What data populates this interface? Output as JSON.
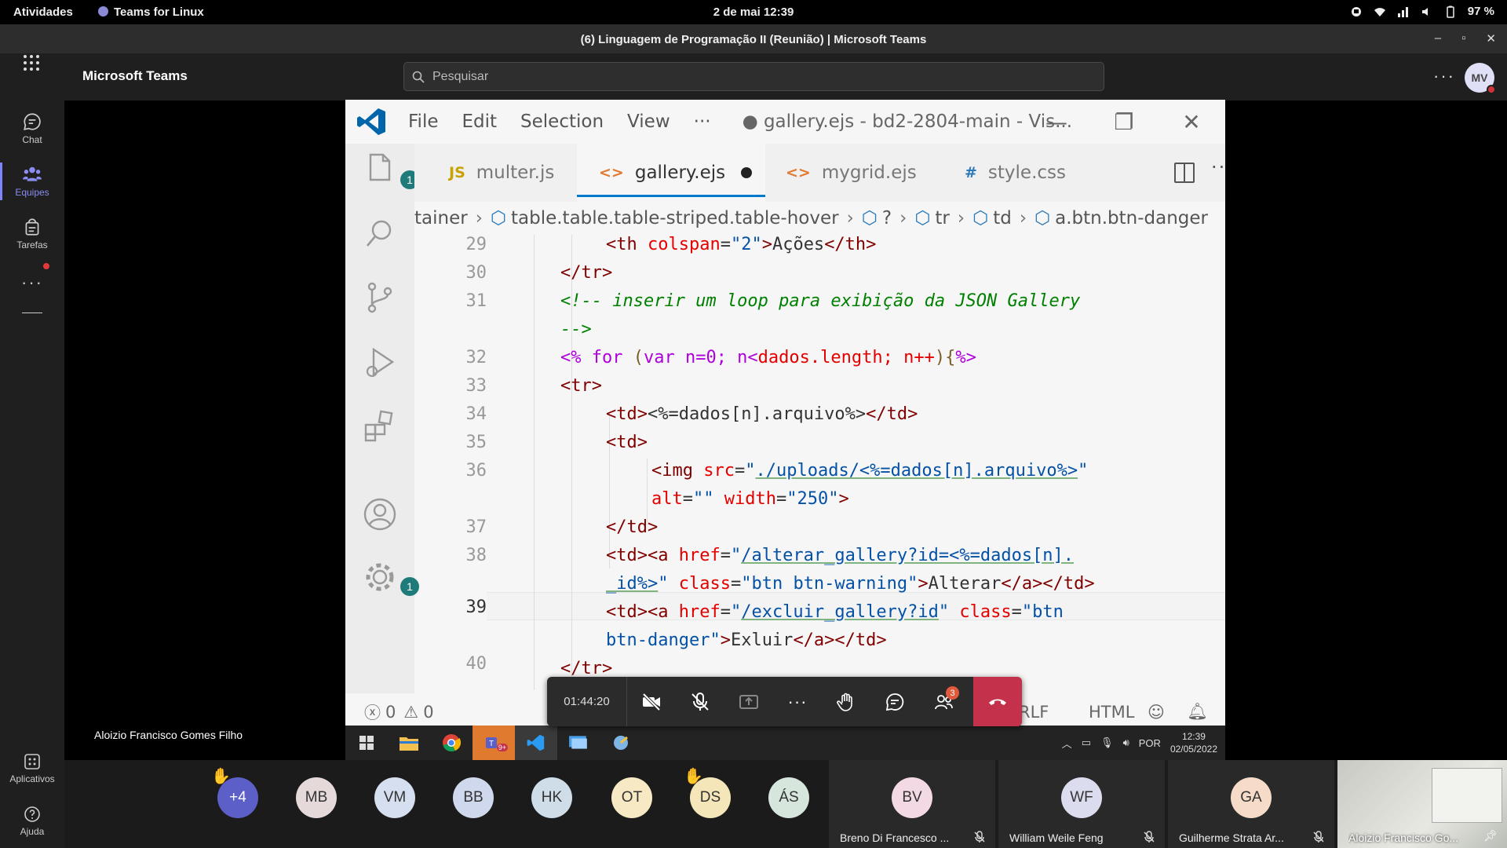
{
  "gnome": {
    "activities": "Atividades",
    "app_name": "Teams for Linux",
    "datetime": "2 de mai  12:39",
    "battery": "97 %"
  },
  "window": {
    "title": "(6) Linguagem de Programação II (Reunião) | Microsoft Teams"
  },
  "rail": {
    "items": [
      {
        "label": "Chat",
        "icon": "chat-icon"
      },
      {
        "label": "Equipes",
        "icon": "teams-icon"
      },
      {
        "label": "Tarefas",
        "icon": "tasks-icon"
      }
    ],
    "bottom": [
      {
        "label": "Aplicativos",
        "icon": "apps-icon"
      },
      {
        "label": "Ajuda",
        "icon": "help-icon"
      }
    ]
  },
  "header": {
    "brand": "Microsoft Teams",
    "search_placeholder": "Pesquisar",
    "avatar": "MV"
  },
  "vscode": {
    "menu": [
      "File",
      "Edit",
      "Selection",
      "View"
    ],
    "title": "● gallery.ejs - bd2-2804-main - Vis...",
    "tabs": [
      {
        "icon": "JS",
        "label": "multer.js"
      },
      {
        "icon": "<>",
        "label": "gallery.ejs",
        "active": true,
        "dirty": true
      },
      {
        "icon": "<>",
        "label": "mygrid.ejs"
      },
      {
        "icon": "#",
        "label": "style.css"
      }
    ],
    "breadcrumb": [
      "tainer",
      "table.table.table-striped.table-hover",
      "?",
      "tr",
      "td",
      "a.btn.btn-danger"
    ],
    "explorer_badge": "1",
    "settings_badge": "1",
    "line_numbers": [
      "29",
      "30",
      "31",
      "32",
      "33",
      "34",
      "35",
      "36",
      "37",
      "38",
      "39",
      "40"
    ],
    "current_line": "39",
    "status": {
      "errors": "0",
      "warnings": "0",
      "eol": "RLF",
      "language": "HTML"
    }
  },
  "call": {
    "timer": "01:44:20",
    "participants_badge": "3",
    "presenter": "Aloizio Francisco Gomes Filho"
  },
  "wintask": {
    "teams_badge": "9+",
    "lang": "POR",
    "time": "12:39",
    "date": "02/05/2022"
  },
  "participants": {
    "avatars": [
      {
        "initials": "+4",
        "color": "#5b5fc7",
        "hand": true
      },
      {
        "initials": "MB",
        "color": "#e6d9d9"
      },
      {
        "initials": "VM",
        "color": "#d5dff0"
      },
      {
        "initials": "BB",
        "color": "#cfd8ec"
      },
      {
        "initials": "HK",
        "color": "#cfdde8"
      },
      {
        "initials": "OT",
        "color": "#f7e9c4"
      },
      {
        "initials": "DS",
        "color": "#f5e6b9",
        "hand": true
      },
      {
        "initials": "ÁS",
        "color": "#d6e6dc"
      }
    ],
    "tiles": [
      {
        "initials": "BV",
        "name": "Breno Di Francesco ...",
        "color": "#f3d9e3"
      },
      {
        "initials": "WF",
        "name": "William Weile Feng",
        "color": "#dcdcef"
      },
      {
        "initials": "GA",
        "name": "Guilherme Strata Ar...",
        "color": "#f6dcc8"
      },
      {
        "name": "Aloizio Francisco Go..."
      }
    ]
  },
  "colors": {
    "teams_accent": "#7f85f5",
    "hangup": "#c4314b",
    "vscode_blue": "#007acc"
  }
}
